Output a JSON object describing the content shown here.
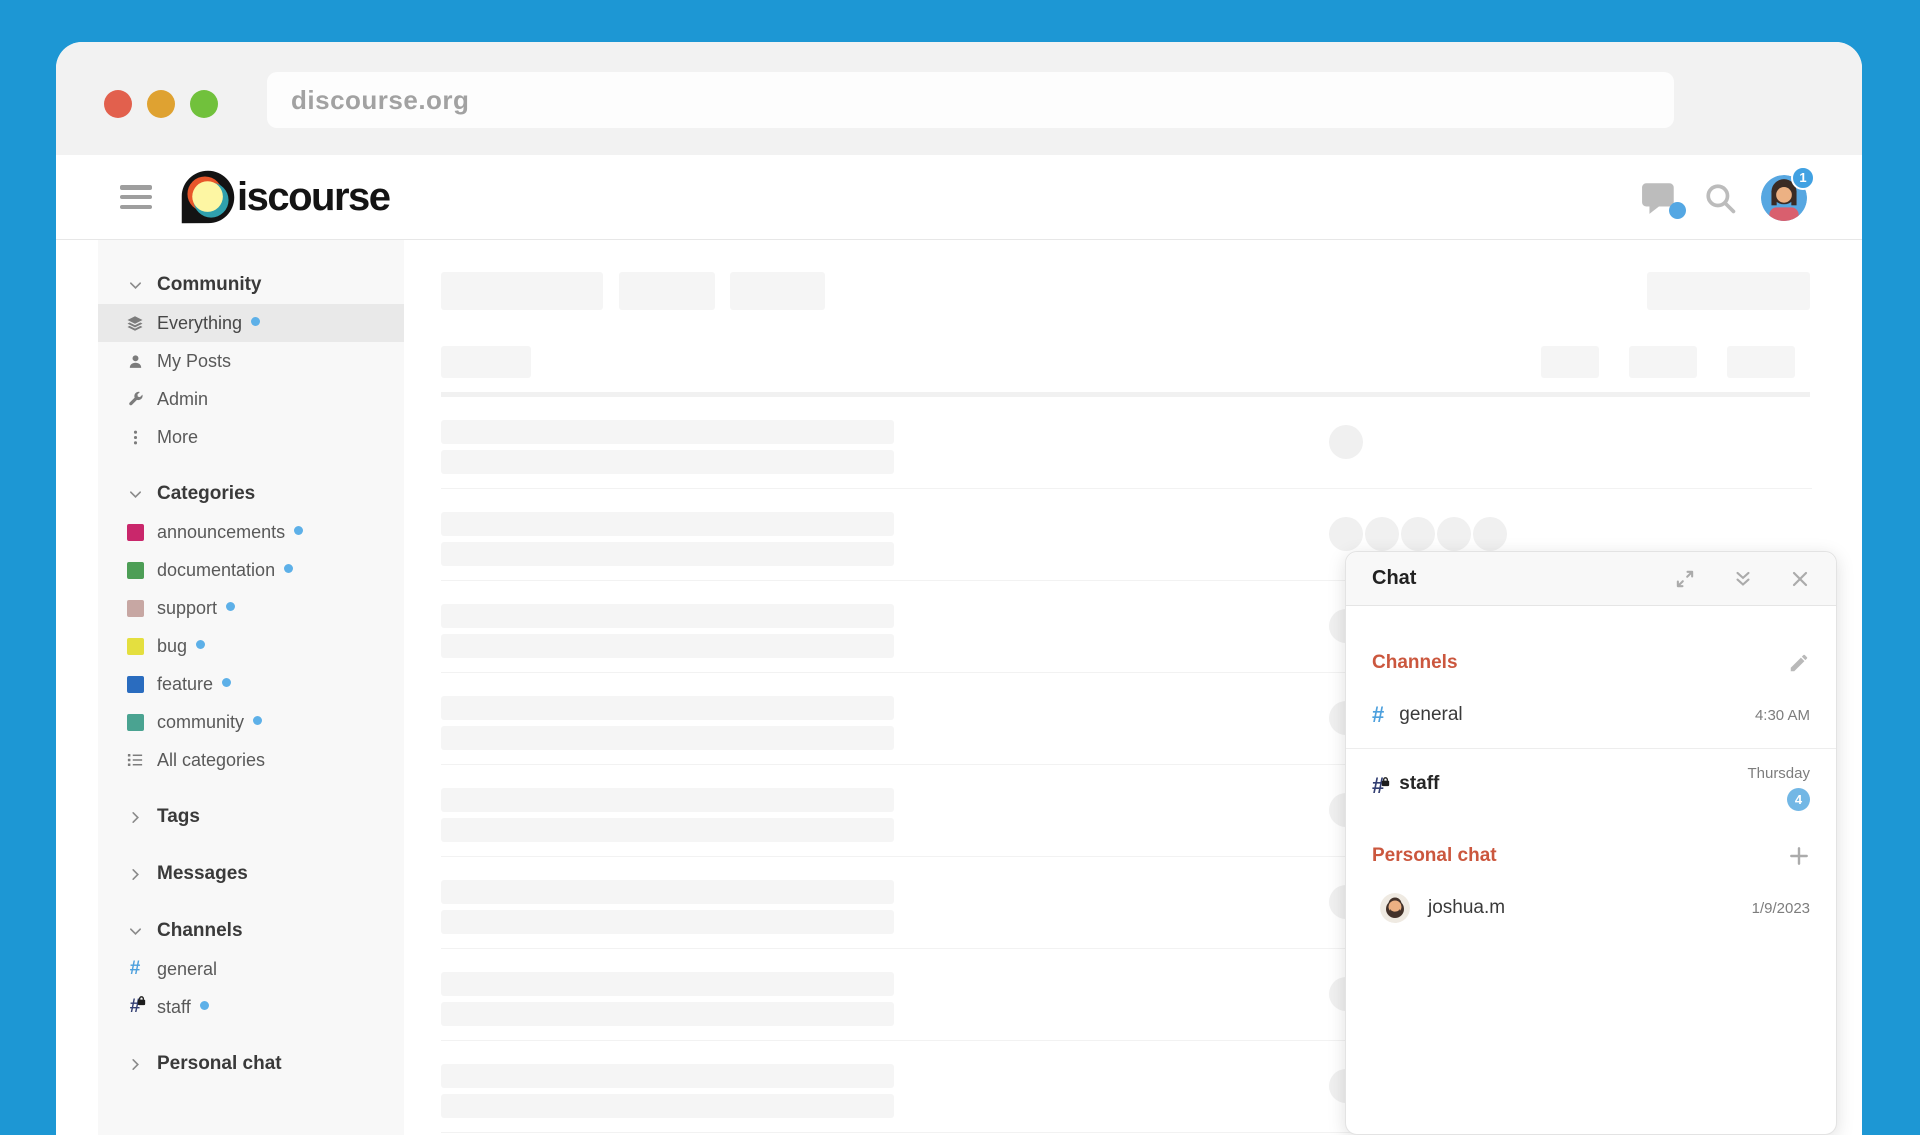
{
  "browser": {
    "url": "discourse.org"
  },
  "header": {
    "logo_text": "iscourse",
    "notification_count": "1",
    "icons": [
      "chat-bubble-icon",
      "search-icon",
      "user-avatar"
    ]
  },
  "colors": {
    "frame_blue": "#1d97d4",
    "accent_blue": "#5db0e8",
    "section_heading_orange": "#cb573e",
    "badge_blue": "#72b7e5"
  },
  "sidebar": {
    "sections": [
      {
        "label": "Community",
        "state": "expanded",
        "items": [
          {
            "label": "Everything",
            "icon": "layers-icon",
            "unread": true,
            "active": true
          },
          {
            "label": "My Posts",
            "icon": "user-icon"
          },
          {
            "label": "Admin",
            "icon": "wrench-icon"
          },
          {
            "label": "More",
            "icon": "ellipsis-icon"
          }
        ]
      },
      {
        "label": "Categories",
        "state": "expanded",
        "items": [
          {
            "label": "announcements",
            "swatch": "#c9276b",
            "unread": true
          },
          {
            "label": "documentation",
            "swatch": "#4d9e56",
            "unread": true
          },
          {
            "label": "support",
            "swatch": "#c7a7a3",
            "unread": true
          },
          {
            "label": "bug",
            "swatch": "#e4df3f",
            "unread": true
          },
          {
            "label": "feature",
            "swatch": "#2a6cbf",
            "unread": true
          },
          {
            "label": "community",
            "swatch": "#4aa391",
            "unread": true
          },
          {
            "label": "All categories",
            "icon": "list-icon"
          }
        ]
      },
      {
        "label": "Tags",
        "state": "collapsed",
        "items": []
      },
      {
        "label": "Messages",
        "state": "collapsed",
        "items": []
      },
      {
        "label": "Channels",
        "state": "expanded",
        "items": [
          {
            "label": "general",
            "icon": "hash-icon",
            "hash_color": "#4da0dd"
          },
          {
            "label": "staff",
            "icon": "hash-lock-icon",
            "hash_color": "#323e72",
            "unread": true
          }
        ]
      },
      {
        "label": "Personal chat",
        "state": "collapsed",
        "items": []
      }
    ]
  },
  "chat": {
    "title": "Chat",
    "header_icons": [
      "expand-icon",
      "collapse-icon",
      "close-icon"
    ],
    "channels_label": "Channels",
    "channels_edit_icon": "pencil-icon",
    "channels": [
      {
        "name": "general",
        "icon": "hash-icon",
        "hash_color": "#4da0dd",
        "time": "4:30 AM",
        "bold": false
      },
      {
        "name": "staff",
        "icon": "hash-lock-icon",
        "hash_color": "#323e72",
        "time": "Thursday",
        "badge": "4",
        "bold": true
      }
    ],
    "personal_label": "Personal chat",
    "personal_add_icon": "plus-icon",
    "direct_messages": [
      {
        "name": "joshua.m",
        "avatar": "joshua-avatar",
        "time": "1/9/2023"
      }
    ]
  }
}
